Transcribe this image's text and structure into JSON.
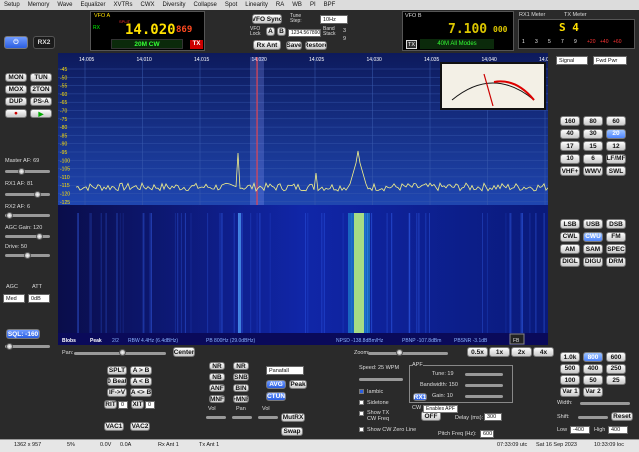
{
  "menu": [
    "Setup",
    "Memory",
    "Wave",
    "Equalizer",
    "XVTRs",
    "CWX",
    "Diversity",
    "Collapse",
    "Spot",
    "Linearity",
    "RA",
    "WB",
    "PI",
    "BPF"
  ],
  "left": {
    "rx2": "RX2",
    "mode_buttons": [
      "MON",
      "TUN",
      "MOX",
      "2TON",
      "DUP",
      "PS-A"
    ],
    "master_af_label": "Master AF:",
    "master_af": "69",
    "rx1_af_label": "RX1 AF:",
    "rx1_af": "81",
    "rx2_af_label": "RX2 AF:",
    "rx2_af": "6",
    "agc_gain_label": "AGC Gain:",
    "agc_gain": "120",
    "drive_label": "Drive:",
    "drive": "50",
    "agc_label": "AGC",
    "att_label": "ATT",
    "agc_value": "Med",
    "att_value": "0dB",
    "sql": "SQL: -160"
  },
  "vfoa": {
    "label": "VFO A",
    "tag": "SPLIT",
    "freq_main": "14.020",
    "freq_sub": "869",
    "rx_tag": "RX",
    "band_mode": "20M CW",
    "tx_tag": "TX"
  },
  "center": {
    "vfo_sync": "VFO Sync",
    "tune_step_label": "Tune Step:",
    "tune_step": "10Hz",
    "vfo_lock_label": "VFO Lock",
    "a": "A",
    "b": "B",
    "lock_value": "1234.567890",
    "band_stack_label": "Band Stack",
    "band_stack_num": "3",
    "band_stack_of": "9",
    "rx_ant": "Rx Ant",
    "save": "Save",
    "restore": "Restore"
  },
  "vfob": {
    "label": "VFO B",
    "freq_main": "7.100",
    "freq_sub": "000",
    "tx_tag": "TX",
    "band_mode": "40M All Modes"
  },
  "meter": {
    "rx1_label": "RX1 Meter",
    "tx_label": "TX Meter",
    "smeter": "S 4",
    "scale": [
      "1",
      "3",
      "5",
      "7",
      "9",
      "+20",
      "+40",
      "+60"
    ],
    "rx_select": "Signal",
    "tx_select": "Fwd Pwr"
  },
  "spectrum": {
    "freq_ticks": [
      "14.005",
      "14.010",
      "14.015",
      "14.020",
      "14.025",
      "14.030",
      "14.035",
      "14.040",
      "14.045"
    ],
    "db_ticks": [
      "-45",
      "-50",
      "-55",
      "-60",
      "-65",
      "-70",
      "-75",
      "-80",
      "-85",
      "-90",
      "-95",
      "-100",
      "-105",
      "-110",
      "-115",
      "-120",
      "-125"
    ],
    "status": [
      "Blobs",
      "Peak",
      "2/2",
      "RBW 4.4Hz (6.4dBHz)",
      "PB 800Hz (29.0dBHz)",
      "NPSD -138.8dBm/Hz",
      "PBNP -107.8dBm",
      "PBSNR -3.1dB"
    ],
    "fb": "FB"
  },
  "pan": {
    "pan_label": "Pan:",
    "center": "Center",
    "zoom_label": "Zoom:",
    "zooms": [
      "0.5x",
      "1x",
      "2x",
      "4x"
    ]
  },
  "bands": [
    "160",
    "80",
    "60",
    "40",
    "30",
    "20",
    "17",
    "15",
    "12",
    "10",
    "6",
    "LF/MF",
    "VHF+",
    "WWV",
    "SWL"
  ],
  "modes": [
    "LSB",
    "USB",
    "DSB",
    "CWL",
    "CWU",
    "FM",
    "AM",
    "SAM",
    "SPEC",
    "DIGL",
    "DIGU",
    "DRM"
  ],
  "filters": [
    "1.0k",
    "800",
    "600",
    "500",
    "400",
    "250",
    "100",
    "50",
    "25",
    "Var 1",
    "Var 2"
  ],
  "filter_width_label": "Width:",
  "shift_label": "Shift:",
  "reset": "Reset",
  "low_label": "Low",
  "high_label": "High",
  "low_value": "-400",
  "high_value": "400",
  "bottom_left": {
    "row1": [
      "SPLT",
      "A > B"
    ],
    "row2": [
      "0 Beat",
      "A < B"
    ],
    "row3": [
      "IF->V",
      "A <> B"
    ],
    "rit": "RIT",
    "rit_value": "0",
    "xit": "XIT",
    "xit_value": "0",
    "vac1": "VAC1",
    "vac2": "VAC2"
  },
  "dsp": {
    "row1": [
      "NR",
      "NR"
    ],
    "row2": [
      "NB",
      "SNB"
    ],
    "row3": [
      "ANF",
      "BIN"
    ],
    "row4": [
      "MNF",
      "+MNF"
    ],
    "display_mode": "Panafall",
    "avg": "AVG",
    "peak": "Peak",
    "ctun": "CTUN",
    "vol": "Vol",
    "pan": "Pan",
    "vol2": "Vol",
    "mutrx": "MutRX",
    "swap": "Swap"
  },
  "cw": {
    "speed_label": "Speed:",
    "speed": "25 WPM",
    "iambic": "Iambic",
    "sidetone": "Sidetone",
    "show_tx": "Show TX CW Freq",
    "show_zero": "Show CW Zero Line",
    "apf_label": "APF",
    "tune_label": "Tune:",
    "tune": "19",
    "bw_label": "Bandwidth:",
    "bw": "150",
    "rx1": "RX1",
    "gain_label": "Gain:",
    "gain": "10",
    "cw_label": "CW",
    "off": "OFF",
    "tooltip": "Enables APF",
    "delay_label": "Delay (ms):",
    "delay": "300",
    "pitch_label": "Pitch Freq (Hz):",
    "pitch": "600"
  },
  "status": {
    "resolution": "1362 x 957",
    "cpu": "5%",
    "volt": "0.0V",
    "amp": "0.0A",
    "rx_ant": "Rx Ant 1",
    "tx_ant": "Tx Ant 1",
    "utc": "07:33:09 utc",
    "date": "Sat 16 Sep 2023",
    "local": "10:33:09 loc"
  }
}
